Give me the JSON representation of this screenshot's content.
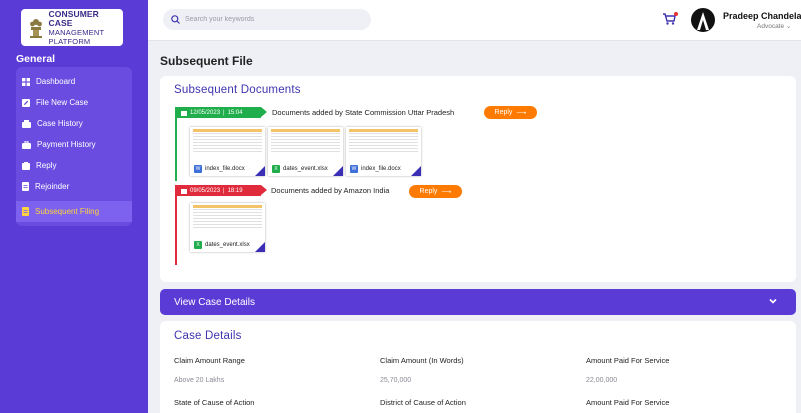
{
  "sidebar": {
    "logo": {
      "line1": "CONSUMER CASE",
      "line2": "MANAGEMENT",
      "line3": "PLATFORM"
    },
    "section_title": "General",
    "items": [
      {
        "label": "Dashboard",
        "icon": "grid-icon"
      },
      {
        "label": "File New Case",
        "icon": "edit-icon"
      },
      {
        "label": "Case History",
        "icon": "history-icon"
      },
      {
        "label": "Payment History",
        "icon": "briefcase-icon"
      },
      {
        "label": "Reply",
        "icon": "reply-icon"
      },
      {
        "label": "Rejoinder",
        "icon": "document-icon"
      },
      {
        "label": "Subsequent Filing",
        "icon": "document-icon",
        "active": true
      }
    ]
  },
  "header": {
    "search_placeholder": "Search your keywords",
    "user_name": "Pradeep Chandela",
    "user_role": "Advocate"
  },
  "page_title": "Subsequent File",
  "subsequent_documents": {
    "title": "Subsequent Documents",
    "entries": [
      {
        "date": "12/05/2023",
        "time": "15:04",
        "description": "Documents added by State Commission Uttar Pradesh",
        "reply_label": "Reply",
        "status_color": "#1fae4b",
        "files": [
          {
            "name": "index_file.docx",
            "type": "word"
          },
          {
            "name": "dates_event.xlsx",
            "type": "excel"
          },
          {
            "name": "index_file.docx",
            "type": "word"
          }
        ]
      },
      {
        "date": "09/05/2023",
        "time": "18:19",
        "description": "Documents added by Amazon India",
        "reply_label": "Reply",
        "status_color": "#e02b3c",
        "files": [
          {
            "name": "dates_event.xlsx",
            "type": "excel"
          }
        ]
      }
    ]
  },
  "view_case_details": {
    "label": "View Case Details"
  },
  "case_details": {
    "title": "Case Details",
    "fields": [
      {
        "label": "Claim Amount Range",
        "value": "Above 20 Lakhs"
      },
      {
        "label": "Claim Amount (In Words)",
        "value": "25,70,000"
      },
      {
        "label": "Amount Paid For Service",
        "value": "22,00,000"
      },
      {
        "label": "State of Cause of Action",
        "value": ""
      },
      {
        "label": "District of Cause of Action",
        "value": ""
      },
      {
        "label": "Amount Paid For Service",
        "value": ""
      }
    ]
  },
  "colors": {
    "sidebar": "#5b3bd6",
    "accent_title": "#3f34b0",
    "reply_button": "#ff7a00",
    "active_menu_text": "#ffd23f"
  }
}
